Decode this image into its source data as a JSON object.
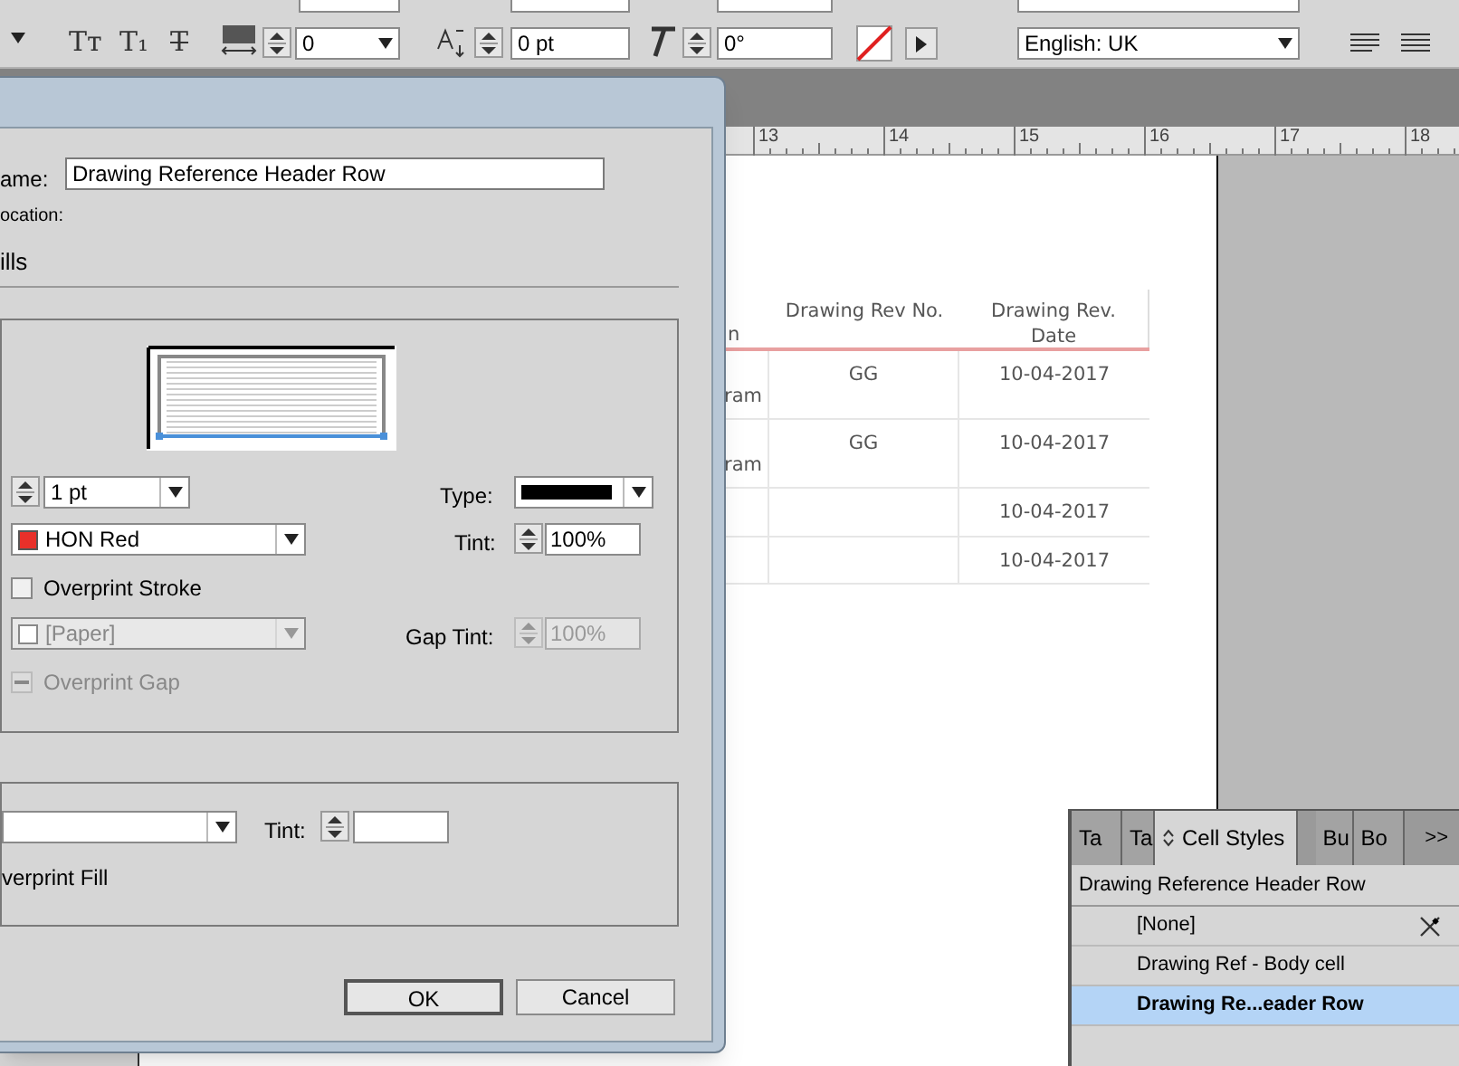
{
  "control_bar": {
    "type_buttons": [
      {
        "kind": "small_caps",
        "glyph": "Tт"
      },
      {
        "kind": "subscript",
        "glyph": "T₁"
      },
      {
        "kind": "strikethrough",
        "glyph": "T"
      }
    ],
    "tracking": "0",
    "baseline_shift": "0 pt",
    "skew": "0°",
    "language": "English: UK"
  },
  "ruler": [
    "13",
    "14",
    "15",
    "16",
    "17",
    "18"
  ],
  "document_table": {
    "columns": [
      "n",
      "Drawing Rev No.",
      "Drawing Rev. Date"
    ],
    "rows": [
      {
        "column_1": "ram",
        "rev_no": "GG",
        "date": "10-04-2017"
      },
      {
        "column_1": "ram",
        "rev_no": "GG",
        "date": "10-04-2017"
      },
      {
        "date": "10-04-2017"
      },
      {
        "date": "10-04-2017"
      }
    ]
  },
  "dialog": {
    "name_label": "ame:",
    "name_value": "Drawing Reference Header Row",
    "location_label": "ocation:",
    "section_title": "ills",
    "stroke": {
      "weight": "1 pt",
      "type_label": "Type:",
      "color": {
        "label": "HON Red",
        "color": "#e8302a"
      },
      "tint_label": "Tint:",
      "tint": "100%",
      "overprint_stroke": {
        "label": "Overprint Stroke",
        "checked": false
      },
      "gap_color": {
        "label": "[Paper]",
        "disabled": true
      },
      "gap_tint_label": "Gap Tint:",
      "gap_tint": {
        "value": "100%",
        "disabled": true
      },
      "overprint_gap": {
        "label": "Overprint Gap",
        "mixed": true,
        "disabled": true
      }
    },
    "fill": {
      "tint_label": "Tint:",
      "overprint_fill": "verprint Fill"
    },
    "buttons": [
      {
        "label": "OK",
        "default": true
      },
      {
        "label": "Cancel",
        "default": false
      }
    ]
  },
  "panel": {
    "tabs": [
      {
        "label": "Ta",
        "selected": false
      },
      {
        "label": "Ta",
        "selected": false
      },
      {
        "label": "Cell Styles",
        "selected": true
      },
      {
        "label": "Bu",
        "selected": false
      },
      {
        "label": "Bo",
        "selected": false
      }
    ],
    "overflow": ">>",
    "current_style": "Drawing Reference Header Row",
    "styles": [
      {
        "label": "[None]",
        "kind": "none",
        "selected": false
      },
      {
        "label": "Drawing Ref - Body cell",
        "kind": "style",
        "selected": false
      },
      {
        "label": "Drawing Re...eader Row",
        "kind": "style",
        "selected": true
      }
    ]
  }
}
